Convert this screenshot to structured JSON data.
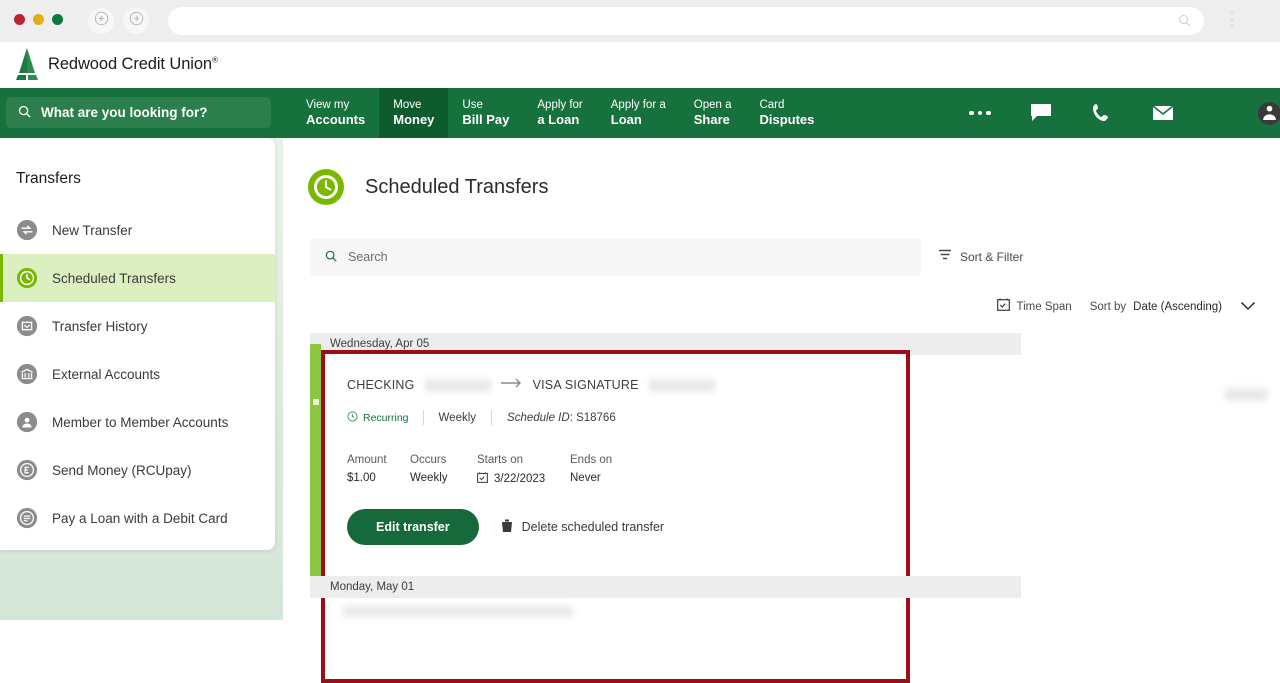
{
  "browser": {
    "back_icon": "arrow-left-circle-icon",
    "forward_icon": "arrow-right-circle-icon",
    "url_value": "",
    "url_placeholder": "",
    "url_search_icon": "search-icon",
    "menu_icon": "kebab-menu-icon",
    "traffic_colors": [
      "#c4202c",
      "#e0b012",
      "#0b7a3c"
    ]
  },
  "brand": {
    "name": "Redwood Credit Union",
    "trademark": "®",
    "logo_icon": "redwood-tree-logo-icon"
  },
  "global_search": {
    "placeholder": "What are you looking for?",
    "icon": "search-icon"
  },
  "topnav": {
    "items": [
      {
        "line1": "View my",
        "line2": "Accounts",
        "active": false
      },
      {
        "line1": "Move",
        "line2": "Money",
        "active": true
      },
      {
        "line1": "Use",
        "line2": "Bill Pay",
        "active": false
      },
      {
        "line1": "Apply for",
        "line2": "a Loan",
        "active": false
      },
      {
        "line1": "Apply for a",
        "line2": "Loan",
        "active": false
      },
      {
        "line1": "Open a",
        "line2": "Share",
        "active": false
      },
      {
        "line1": "Card",
        "line2": "Disputes",
        "active": false
      }
    ],
    "more_icon": "ellipsis-icon",
    "icons": [
      "chat-bubble-icon",
      "phone-icon",
      "envelope-icon"
    ],
    "avatar_icon": "user-avatar-icon"
  },
  "sidebar": {
    "title": "Transfers",
    "items": [
      {
        "label": "New Transfer",
        "icon": "transfer-arrows-icon",
        "active": false
      },
      {
        "label": "Scheduled Transfers",
        "icon": "clock-icon",
        "active": true
      },
      {
        "label": "Transfer History",
        "icon": "history-box-icon",
        "active": false
      },
      {
        "label": "External Accounts",
        "icon": "bank-icon",
        "active": false
      },
      {
        "label": "Member to Member Accounts",
        "icon": "people-icon",
        "active": false
      },
      {
        "label": "Send Money (RCUpay)",
        "icon": "e-badge-icon",
        "active": false
      },
      {
        "label": "Pay a Loan with a Debit Card",
        "icon": "document-lines-icon",
        "active": false
      }
    ]
  },
  "main": {
    "page_title": "Scheduled Transfers",
    "page_icon": "green-clock-icon",
    "search": {
      "placeholder": "Search",
      "icon": "search-icon"
    },
    "sort_filter": {
      "label": "Sort & Filter",
      "icon": "filter-icon"
    },
    "controls": {
      "time_span_label": "Time Span",
      "time_span_icon": "calendar-icon",
      "sort_by_label": "Sort by",
      "sort_by_value": "Date (Ascending)",
      "chevron_icon": "chevron-down-icon"
    },
    "day_groups": [
      {
        "label": "Wednesday, Apr 05"
      },
      {
        "label": "Monday, May 01"
      }
    ],
    "transfer": {
      "from_account": "CHECKING",
      "from_masked": "redacted",
      "arrow_icon": "arrow-right-icon",
      "to_account": "VISA SIGNATURE",
      "to_masked": "redacted",
      "recurring_label": "Recurring",
      "recurring_icon": "clock-icon",
      "frequency": "Weekly",
      "schedule_id_label": "Schedule ID",
      "schedule_id_value": "S18766",
      "details": [
        {
          "label": "Amount",
          "value": "$1.00",
          "icon": ""
        },
        {
          "label": "Occurs",
          "value": "Weekly",
          "icon": ""
        },
        {
          "label": "Starts on",
          "value": "3/22/2023",
          "icon": "calendar-icon"
        },
        {
          "label": "Ends on",
          "value": "Never",
          "icon": ""
        }
      ],
      "edit_button": "Edit transfer",
      "delete_label": "Delete scheduled transfer",
      "delete_icon": "trash-icon",
      "right_amount_masked": "redacted"
    },
    "highlight_color": "#9a0f16",
    "accent_color": "#8cc63e"
  },
  "colors": {
    "brand_green": "#17713c",
    "nav_active_green": "#0e5c2e",
    "accent_lime": "#8cc63e",
    "sidebar_active": "#dcefc0",
    "button_green": "#15693a"
  }
}
